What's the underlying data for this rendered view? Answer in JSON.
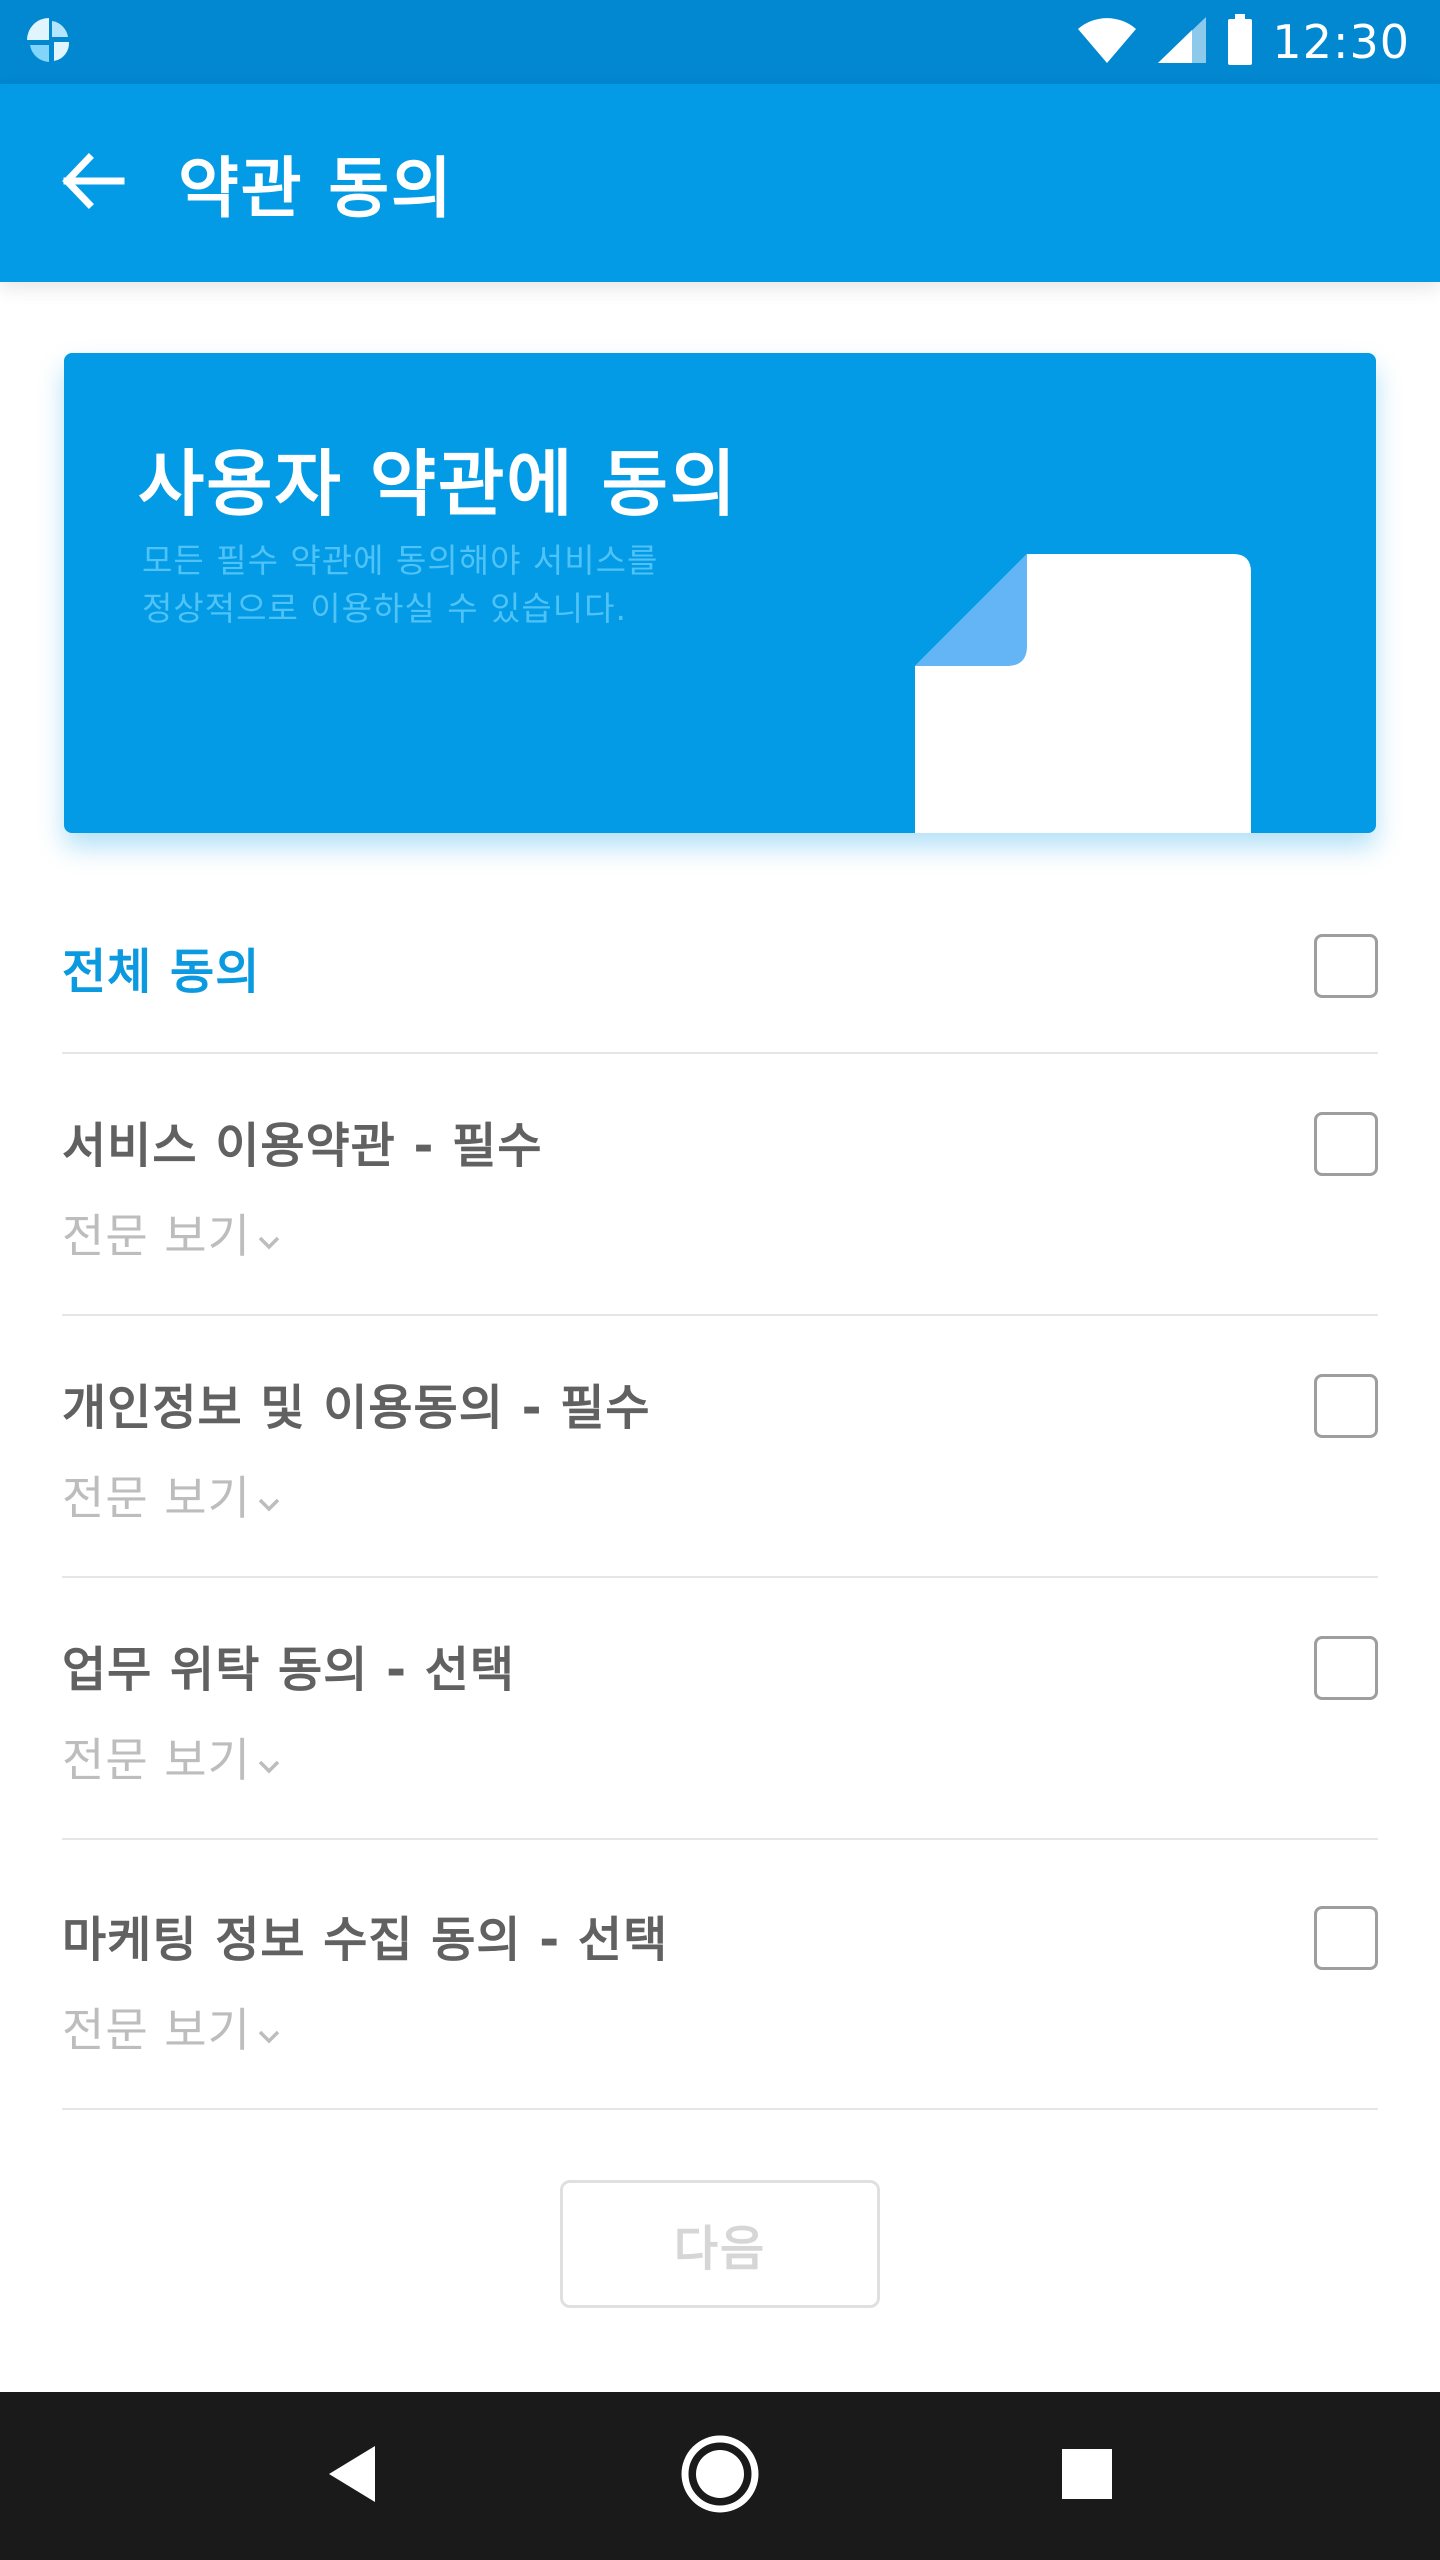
{
  "status_bar": {
    "time": "12:30",
    "icons": [
      "app-logo-icon",
      "wifi-icon",
      "signal-icon",
      "battery-icon"
    ]
  },
  "app_bar": {
    "title": "약관 동의",
    "back_icon": "arrow-back-icon"
  },
  "banner": {
    "title": "사용자 약관에 동의",
    "description_line1": "모든 필수 약관에 동의해야 서비스를",
    "description_line2": "정상적으로 이용하실 수 있습니다.",
    "illustration": "document-icon"
  },
  "terms": {
    "agree_all": {
      "label": "전체 동의",
      "checked": false
    },
    "items": [
      {
        "label": "서비스 이용약관 - 필수",
        "view_full": "전문 보기",
        "checked": false
      },
      {
        "label": "개인정보 및 이용동의 - 필수",
        "view_full": "전문 보기",
        "checked": false
      },
      {
        "label": "업무 위탁 동의 - 선택",
        "view_full": "전문 보기",
        "checked": false
      },
      {
        "label": "마케팅 정보 수집 동의 - 선택",
        "view_full": "전문 보기",
        "checked": false
      }
    ]
  },
  "next_button": {
    "label": "다음",
    "enabled": false
  },
  "nav_bar": {
    "icons": [
      "back-triangle-icon",
      "home-circle-icon",
      "recents-square-icon"
    ]
  },
  "colors": {
    "status_bar": "#0288d1",
    "primary": "#039be5",
    "accent_text": "#0b9ae0",
    "banner_subtext": "#4fc3f7",
    "label_text": "#616161",
    "muted_text": "#bdbdbd",
    "divider": "#e6e6e6",
    "nav_bar": "#1a1a1a"
  }
}
